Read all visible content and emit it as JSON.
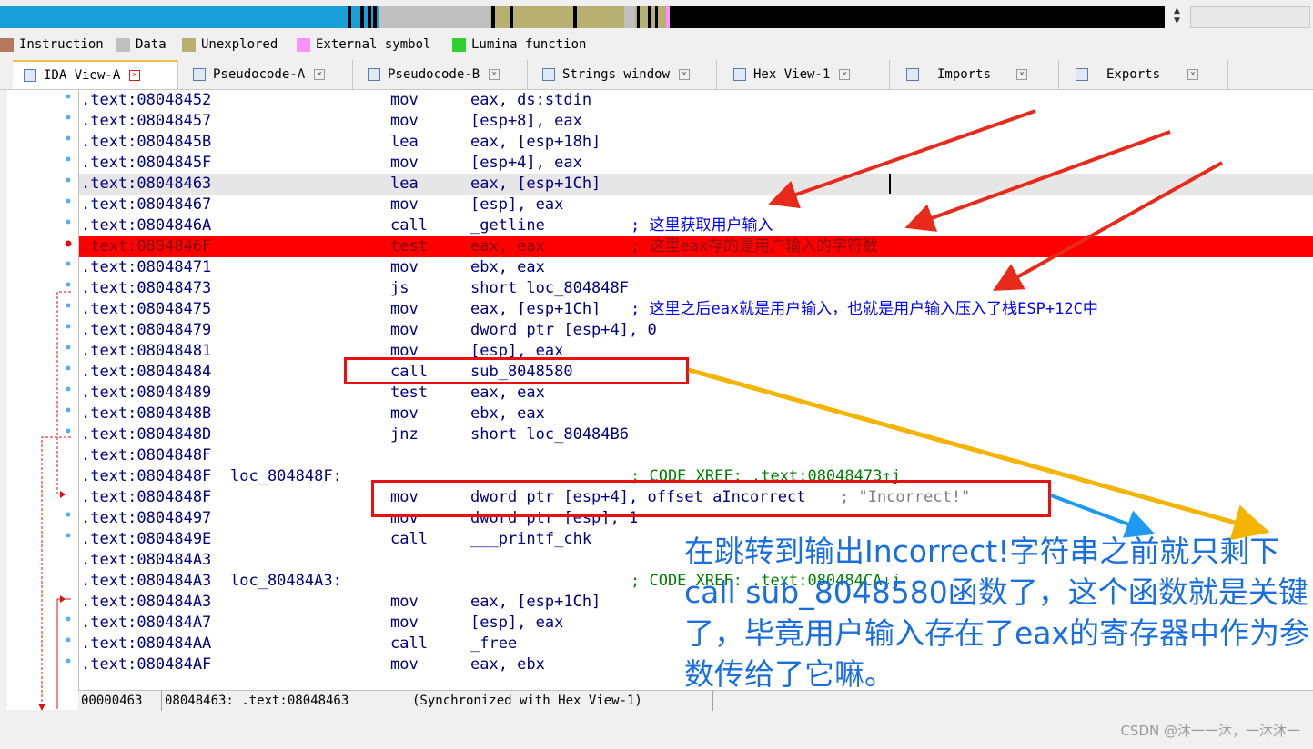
{
  "colors": {
    "accent": "#1aa0d9",
    "breakpoint": "#ff0000",
    "highlight_box": "#e81010",
    "annotation_text": "#1a6fe0",
    "arrow_red": "#e82a1a",
    "arrow_yellow": "#f5b400",
    "arrow_blue": "#1e9af0"
  },
  "legend": [
    {
      "label": "Instruction",
      "color": "#b4785a"
    },
    {
      "label": "Data",
      "color": "#c0c0c0"
    },
    {
      "label": "Unexplored",
      "color": "#b8b070"
    },
    {
      "label": "External symbol",
      "color": "#ff90ff"
    },
    {
      "label": "Lumina function",
      "color": "#30d030"
    }
  ],
  "tabs": [
    {
      "label": "IDA View-A",
      "icon": "ida-view-icon",
      "active": true
    },
    {
      "label": "Pseudocode-A",
      "icon": "pseudocode-icon",
      "active": false
    },
    {
      "label": "Pseudocode-B",
      "icon": "pseudocode-icon",
      "active": false
    },
    {
      "label": "Strings window",
      "icon": "strings-icon",
      "active": false
    },
    {
      "label": "Hex View-1",
      "icon": "hex-icon",
      "active": false
    },
    {
      "label": "Imports",
      "icon": "imports-icon",
      "active": false
    },
    {
      "label": "Exports",
      "icon": "exports-icon",
      "active": false
    }
  ],
  "tab_close_glyph": "×",
  "code": [
    {
      "addr": ".text:08048452",
      "mn": "mov",
      "op": "eax, ds:stdin"
    },
    {
      "addr": ".text:08048457",
      "mn": "mov",
      "op": "[esp+8], eax"
    },
    {
      "addr": ".text:0804845B",
      "mn": "lea",
      "op": "eax, [esp+18h]"
    },
    {
      "addr": ".text:0804845F",
      "mn": "mov",
      "op": "[esp+4], eax"
    },
    {
      "addr": ".text:08048463",
      "mn": "lea",
      "op": "eax, [esp+1Ch]"
    },
    {
      "addr": ".text:08048467",
      "mn": "mov",
      "op": "[esp], eax"
    },
    {
      "addr": ".text:0804846A",
      "mn": "call",
      "op": "_getline",
      "comment": "; 这里获取用户输入"
    },
    {
      "addr": ".text:0804846F",
      "mn": "test",
      "op": "eax, eax",
      "comment": "; 这里eax存的是用户输入的字符数"
    },
    {
      "addr": ".text:08048471",
      "mn": "mov",
      "op": "ebx, eax"
    },
    {
      "addr": ".text:08048473",
      "mn": "js",
      "op": "short loc_804848F"
    },
    {
      "addr": ".text:08048475",
      "mn": "mov",
      "op": "eax, [esp+1Ch]",
      "comment": "; 这里之后eax就是用户输入，也就是用户输入压入了栈ESP+12C中"
    },
    {
      "addr": ".text:08048479",
      "mn": "mov",
      "op": "dword ptr [esp+4], 0"
    },
    {
      "addr": ".text:08048481",
      "mn": "mov",
      "op": "[esp], eax"
    },
    {
      "addr": ".text:08048484",
      "mn": "call",
      "op": "sub_8048580"
    },
    {
      "addr": ".text:08048489",
      "mn": "test",
      "op": "eax, eax"
    },
    {
      "addr": ".text:0804848B",
      "mn": "mov",
      "op": "ebx, eax"
    },
    {
      "addr": ".text:0804848D",
      "mn": "jnz",
      "op": "short loc_80484B6"
    },
    {
      "addr": ".text:0804848F",
      "mn": "",
      "op": ""
    },
    {
      "addr": ".text:0804848F",
      "label": "loc_804848F:",
      "mn": "",
      "op": "",
      "xref": "; CODE XREF: .text:08048473↑j"
    },
    {
      "addr": ".text:0804848F",
      "mn": "mov",
      "op": "dword ptr [esp+4], offset aIncorrect",
      "str": "; \"Incorrect!\""
    },
    {
      "addr": ".text:08048497",
      "mn": "mov",
      "op": "dword ptr [esp], 1"
    },
    {
      "addr": ".text:0804849E",
      "mn": "call",
      "op": "___printf_chk"
    },
    {
      "addr": ".text:080484A3",
      "mn": "",
      "op": ""
    },
    {
      "addr": ".text:080484A3",
      "label": "loc_80484A3:",
      "mn": "",
      "op": "",
      "xref": "; CODE XREF: .text:080484CA↓j"
    },
    {
      "addr": ".text:080484A3",
      "mn": "mov",
      "op": "eax, [esp+1Ch]"
    },
    {
      "addr": ".text:080484A7",
      "mn": "mov",
      "op": "[esp], eax"
    },
    {
      "addr": ".text:080484AA",
      "mn": "call",
      "op": "_free"
    },
    {
      "addr": ".text:080484AF",
      "mn": "mov",
      "op": "eax, ebx"
    }
  ],
  "status": {
    "offset": "00000463",
    "location": "08048463: .text:08048463",
    "sync": "(Synchronized with Hex View-1)"
  },
  "annotation": "在跳转到输出Incorrect!字符串之前就只剩下call sub_8048580函数了，这个函数就是关键了，毕竟用户输入存在了eax的寄存器中作为参数传给了它嘛。",
  "watermark": "CSDN @沐一一沐，一沐沐一"
}
